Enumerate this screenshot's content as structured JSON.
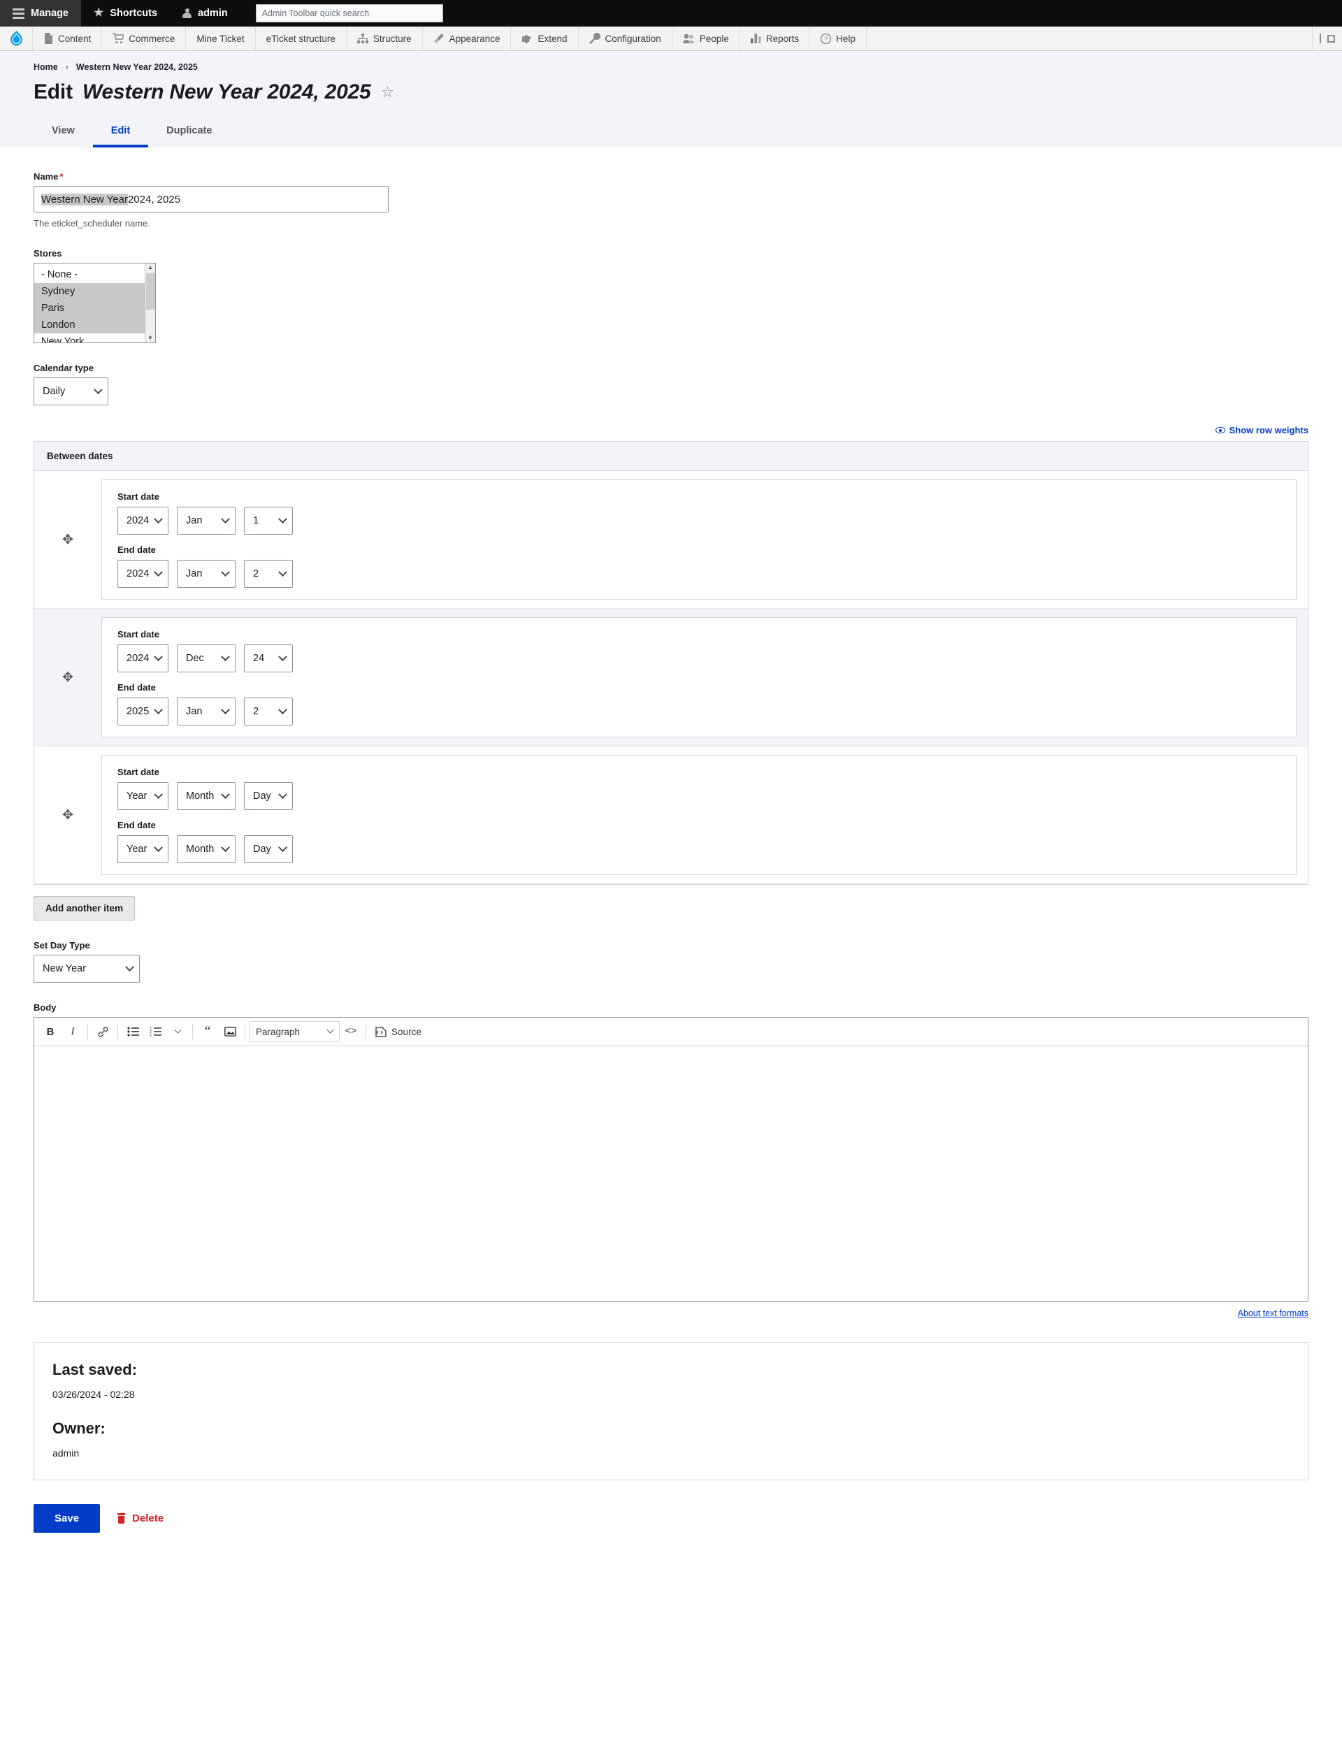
{
  "toolbar": {
    "manage": "Manage",
    "shortcuts": "Shortcuts",
    "account": "admin",
    "search_placeholder": "Admin Toolbar quick search",
    "menu": [
      {
        "label": "Content",
        "icon": "page-icon"
      },
      {
        "label": "Commerce",
        "icon": "cart-icon"
      },
      {
        "label": "Mine Ticket",
        "icon": "none"
      },
      {
        "label": "eTicket structure",
        "icon": "none"
      },
      {
        "label": "Structure",
        "icon": "sitemap-icon"
      },
      {
        "label": "Appearance",
        "icon": "brush-icon"
      },
      {
        "label": "Extend",
        "icon": "puzzle-icon"
      },
      {
        "label": "Configuration",
        "icon": "wrench-icon"
      },
      {
        "label": "People",
        "icon": "people-icon"
      },
      {
        "label": "Reports",
        "icon": "bars-icon"
      },
      {
        "label": "Help",
        "icon": "question-icon"
      }
    ]
  },
  "breadcrumb": {
    "home": "Home",
    "separator": "›",
    "current": "Western New Year 2024, 2025"
  },
  "page": {
    "title_prefix": "Edit",
    "title_entity": "Western New Year 2024, 2025",
    "star": "☆"
  },
  "tabs": [
    {
      "label": "View",
      "active": false
    },
    {
      "label": "Edit",
      "active": true
    },
    {
      "label": "Duplicate",
      "active": false
    }
  ],
  "form": {
    "name": {
      "label": "Name",
      "required": "*",
      "value_selected": "Western New Year",
      "value_rest": " 2024, 2025",
      "description": "The eticket_scheduler name."
    },
    "stores": {
      "label": "Stores",
      "options": [
        {
          "label": "- None -",
          "selected": false
        },
        {
          "label": "Sydney",
          "selected": true
        },
        {
          "label": "Paris",
          "selected": true
        },
        {
          "label": "London",
          "selected": true
        },
        {
          "label": "New York",
          "selected": false
        }
      ]
    },
    "calendar_type": {
      "label": "Calendar type",
      "value": "Daily"
    },
    "show_row_weights": "Show row weights",
    "between_dates_header": "Between dates",
    "date_rows": [
      {
        "start_label": "Start date",
        "start": {
          "year": "2024",
          "month": "Jan",
          "day": "1"
        },
        "end_label": "End date",
        "end": {
          "year": "2024",
          "month": "Jan",
          "day": "2"
        }
      },
      {
        "start_label": "Start date",
        "start": {
          "year": "2024",
          "month": "Dec",
          "day": "24"
        },
        "end_label": "End date",
        "end": {
          "year": "2025",
          "month": "Jan",
          "day": "2"
        }
      },
      {
        "start_label": "Start date",
        "start": {
          "year": "Year",
          "month": "Month",
          "day": "Day"
        },
        "end_label": "End date",
        "end": {
          "year": "Year",
          "month": "Month",
          "day": "Day"
        }
      }
    ],
    "add_another": "Add another item",
    "day_type": {
      "label": "Set Day Type",
      "value": "New Year"
    },
    "body": {
      "label": "Body",
      "paragraph_format": "Paragraph",
      "source_label": "Source",
      "content": "",
      "about_text_formats": "About text formats"
    }
  },
  "meta": {
    "last_saved_label": "Last saved:",
    "last_saved_value": "03/26/2024 - 02:28",
    "owner_label": "Owner:",
    "owner_value": "admin"
  },
  "actions": {
    "save": "Save",
    "delete": "Delete"
  },
  "colors": {
    "accent": "#003cc5",
    "danger": "#d72222",
    "toolbar_bg": "#0d0d0d",
    "header_bg": "#f3f4f9"
  }
}
